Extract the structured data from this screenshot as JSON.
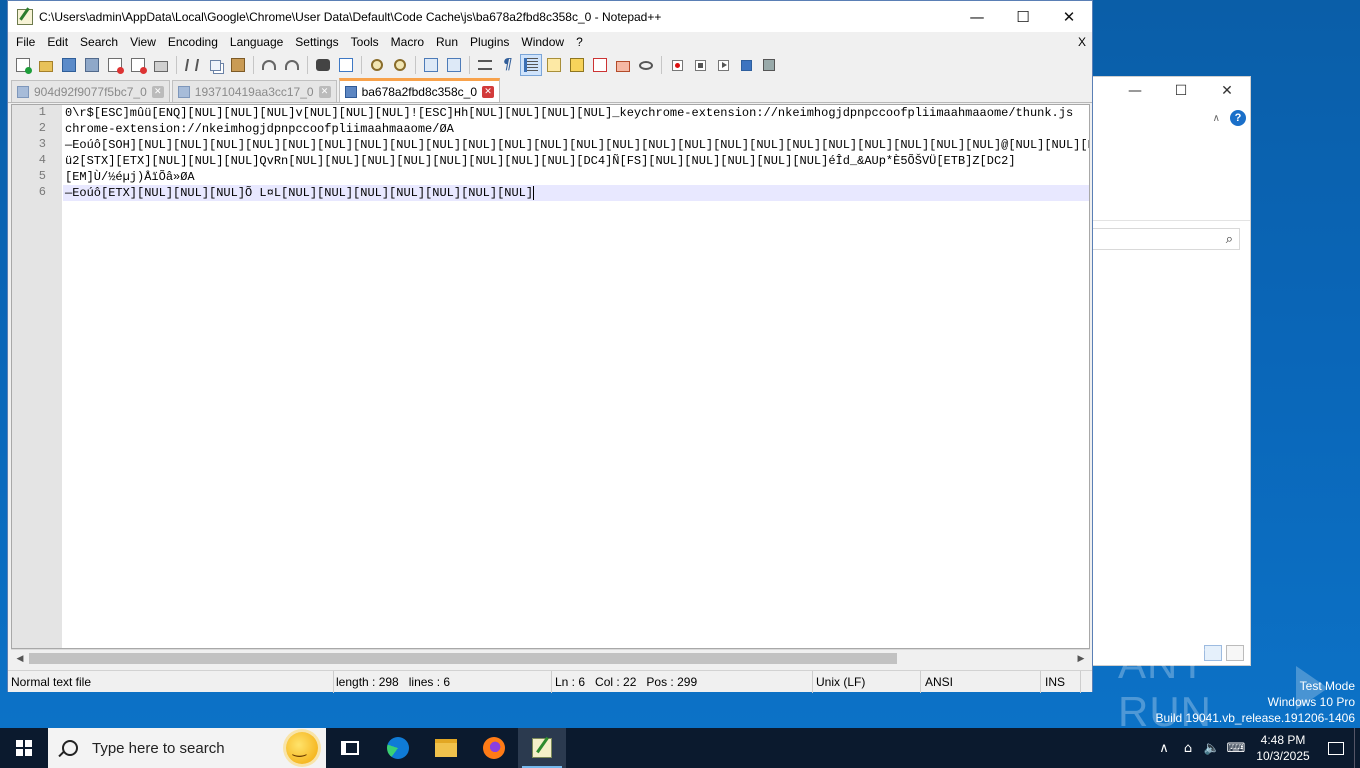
{
  "window": {
    "title": "C:\\Users\\admin\\AppData\\Local\\Google\\Chrome\\User Data\\Default\\Code Cache\\js\\ba678a2fbd8c358c_0 - Notepad++",
    "minimize": "—",
    "maximize": "☐",
    "close": "✕"
  },
  "menu": {
    "items": [
      "File",
      "Edit",
      "Search",
      "View",
      "Encoding",
      "Language",
      "Settings",
      "Tools",
      "Macro",
      "Run",
      "Plugins",
      "Window",
      "?"
    ],
    "close_label": "X"
  },
  "toolbar_icons": [
    "new-file-icon",
    "open-file-icon",
    "save-icon",
    "save-all-icon",
    "close-file-icon",
    "close-all-icon",
    "print-icon",
    "cut-icon",
    "copy-icon",
    "paste-icon",
    "undo-icon",
    "redo-icon",
    "find-icon",
    "replace-icon",
    "zoom-in-icon",
    "zoom-out-icon",
    "sync-scroll-v-icon",
    "sync-scroll-h-icon",
    "word-wrap-icon",
    "show-all-chars-icon",
    "indent-guide-icon",
    "document-map-icon",
    "function-list-icon",
    "folder-as-workspace-icon",
    "project-panel-icon",
    "monitoring-icon",
    "record-macro-icon",
    "stop-record-icon",
    "playback-macro-icon",
    "run-macro-multiple-icon",
    "save-macro-icon"
  ],
  "tabs": [
    {
      "label": "904d92f9077f5bc7_0",
      "active": false
    },
    {
      "label": "193710419aa3cc17_0",
      "active": false
    },
    {
      "label": "ba678a2fbd8c358c_0",
      "active": true
    }
  ],
  "editor": {
    "line_numbers": [
      "1",
      "2",
      "3",
      "4",
      "5",
      "6"
    ],
    "lines": [
      "0\\r$[ESC]mûü[ENQ][NUL][NUL][NUL]v[NUL][NUL][NUL]![ESC]Hh[NUL][NUL][NUL][NUL]_keychrome-extension://nkeimhogjdpnpccoofpliimaahmaaome/thunk.js",
      "chrome-extension://nkeimhogjdpnpccoofpliimaahmaaome/ØA",
      "—Eoúô[SOH][NUL][NUL][NUL][NUL][NUL][NUL][NUL][NUL][NUL][NUL][NUL][NUL][NUL][NUL][NUL][NUL][NUL][NUL][NUL][NUL][NUL][NUL][NUL][NUL]@[NUL][NUL][NUL][EOT][NUL][NUL][NUL][NUL][NUL][NUL][NUL][NUL]iB÷E",
      "ü2[STX][ETX][NUL][NUL][NUL]QvRn[NUL][NUL][NUL][NUL][NUL][NUL][NUL][NUL][DC4]Ñ[FS][NUL][NUL][NUL][NUL][NUL]éÎd_&AUp*È5ÕŠVÜ[ETB]Z[DC2]",
      "[EM]Ù/½éµj)ÅïÕâ»ØA",
      "—Eoúô[ETX][NUL][NUL][NUL]Õ L¤L[NUL][NUL][NUL][NUL][NUL][NUL][NUL]"
    ],
    "current_line": 6
  },
  "status": {
    "file_type": "Normal text file",
    "length": "length : 298",
    "lines": "lines : 6",
    "ln": "Ln : 6",
    "col": "Col : 22",
    "pos": "Pos : 299",
    "eol": "Unix (LF)",
    "encoding": "ANSI",
    "mode": "INS"
  },
  "bg_window": {
    "minimize": "—",
    "maximize": "☐",
    "close": "✕",
    "help": "?",
    "collapse": "∧",
    "search_icon": "⌕"
  },
  "watermark": {
    "brand": "ANY RUN",
    "test_mode": "Test Mode",
    "os": "Windows 10 Pro",
    "build": "Build 19041.vb_release.191206-1406"
  },
  "taskbar": {
    "search_placeholder": "Type here to search",
    "apps": [
      "task-view",
      "edge",
      "file-explorer",
      "firefox",
      "notepad-plus-plus"
    ],
    "tray_chevron": "∧",
    "time": "4:48 PM",
    "date": "10/3/2025"
  }
}
